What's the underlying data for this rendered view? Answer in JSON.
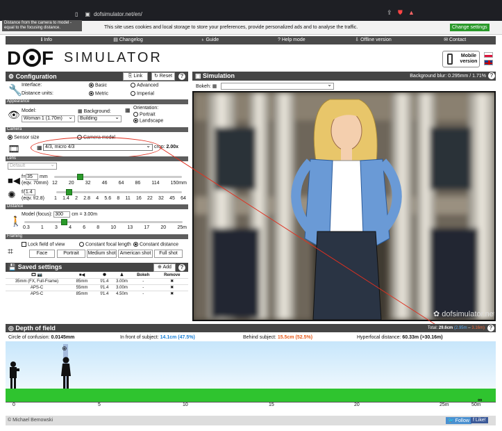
{
  "browser": {
    "url": "dofsimulator.net/en/"
  },
  "tooltip": "Distance from the camera to model - equal to the focusing distance.",
  "cookie": {
    "text": "This site uses cookies and local storage to store your preferences, provide personalized ads and to analyse the traffic.",
    "button": "Change settings"
  },
  "nav": [
    "Info",
    "Changelog",
    "Guide",
    "Help mode",
    "Offline version",
    "Contact"
  ],
  "logo": {
    "brand": "SIMULATOR",
    "mobile": "Mobile version"
  },
  "config": {
    "title": "Configuration",
    "link": "Link",
    "reset": "Reset",
    "interface_label": "Interface:",
    "basic": "Basic",
    "advanced": "Advanced",
    "units_label": "Distance units:",
    "metric": "Metric",
    "imperial": "Imperial"
  },
  "appearance": {
    "head": "Appearance",
    "model_label": "Model:",
    "model_value": "Woman 1 (1.70m)",
    "bg_label": "Background:",
    "bg_value": "Building",
    "orient_label": "Orientation:",
    "portrait": "Portrait",
    "landscape": "Landscape"
  },
  "camera": {
    "head": "Camera",
    "sensor_size": "Sensor size",
    "camera_model": "Camera model",
    "sensor_value": "4/3, micro 4/3",
    "crop_label": "crop:",
    "crop_value": "2.00x"
  },
  "lens": {
    "head": "Lens",
    "preset": "Default",
    "focal_prefix": "f=",
    "focal_value": "35",
    "focal_unit": "mm",
    "focal_eqv": "(eqv. 70mm)",
    "focal_ticks": [
      "12",
      "20",
      "32",
      "46",
      "64",
      "86",
      "114",
      "150mm"
    ],
    "focal_pos": 0.2,
    "aperture_prefix": "f/",
    "aperture_value": "1.4",
    "aperture_eqv": "(eqv. f/2.8)",
    "aperture_ticks": [
      "1",
      "1.4",
      "2",
      "2.8",
      "4",
      "5.6",
      "8",
      "11",
      "16",
      "22",
      "32",
      "45",
      "64"
    ],
    "aperture_pos": 0.1
  },
  "distance": {
    "head": "Distance",
    "label": "Model (focus):",
    "value": "300",
    "suffix": "cm = 3.00m",
    "ticks": [
      "0.3",
      "1",
      "3",
      "4",
      "6",
      "8",
      "10",
      "13",
      "17",
      "20",
      "25m"
    ],
    "pos": 0.25
  },
  "framing": {
    "head": "Framing",
    "lock": "Lock field of view",
    "const_focal": "Constant focal length",
    "const_dist": "Constant distance",
    "buttons": [
      "Face",
      "Portrait",
      "Medium shot",
      "American shot",
      "Full shot"
    ]
  },
  "saved": {
    "title": "Saved settings",
    "add": "Add",
    "headers": [
      "Bokeh",
      "Remove"
    ],
    "rows": [
      {
        "name": "35mm (FX, Full-Frame)",
        "focal": "85mm",
        "aperture": "f/1.4",
        "dist": "3.00m",
        "bokeh": "-"
      },
      {
        "name": "APS-C",
        "focal": "55mm",
        "aperture": "f/1.4",
        "dist": "3.00m",
        "bokeh": "-"
      },
      {
        "name": "APS-C",
        "focal": "85mm",
        "aperture": "f/1.4",
        "dist": "4.50m",
        "bokeh": "-"
      }
    ]
  },
  "simulation": {
    "title": "Simulation",
    "blur": "Background blur: 0.295mm / 1.71%",
    "bokeh_label": "Bokeh:",
    "watermark": "dofsimulator.net"
  },
  "dof": {
    "title": "Depth of field",
    "total_label": "Total:",
    "total": "29.6cm",
    "total_split_a": "(2.95m",
    "total_split_b": "3.16m)",
    "coc_label": "Circle of confusion:",
    "coc": "0.0145mm",
    "front_label": "In front of subject:",
    "front": "14.1cm (47.5%)",
    "behind_label": "Behind subject:",
    "behind": "15.5cm (52.5%)",
    "hyper_label": "Hyperfocal distance:",
    "hyper": "60.33m (>30.16m)",
    "axis": [
      "0",
      "5",
      "10",
      "15",
      "20",
      "25m",
      "50m"
    ],
    "inf": "∞"
  },
  "footer": {
    "author": "© Michael Bemowski",
    "follow": "Follow",
    "like": "Like!"
  },
  "colors": {
    "accent": "#2a9a2a",
    "front": "#1a7fd6",
    "behind": "#e85a1a"
  }
}
